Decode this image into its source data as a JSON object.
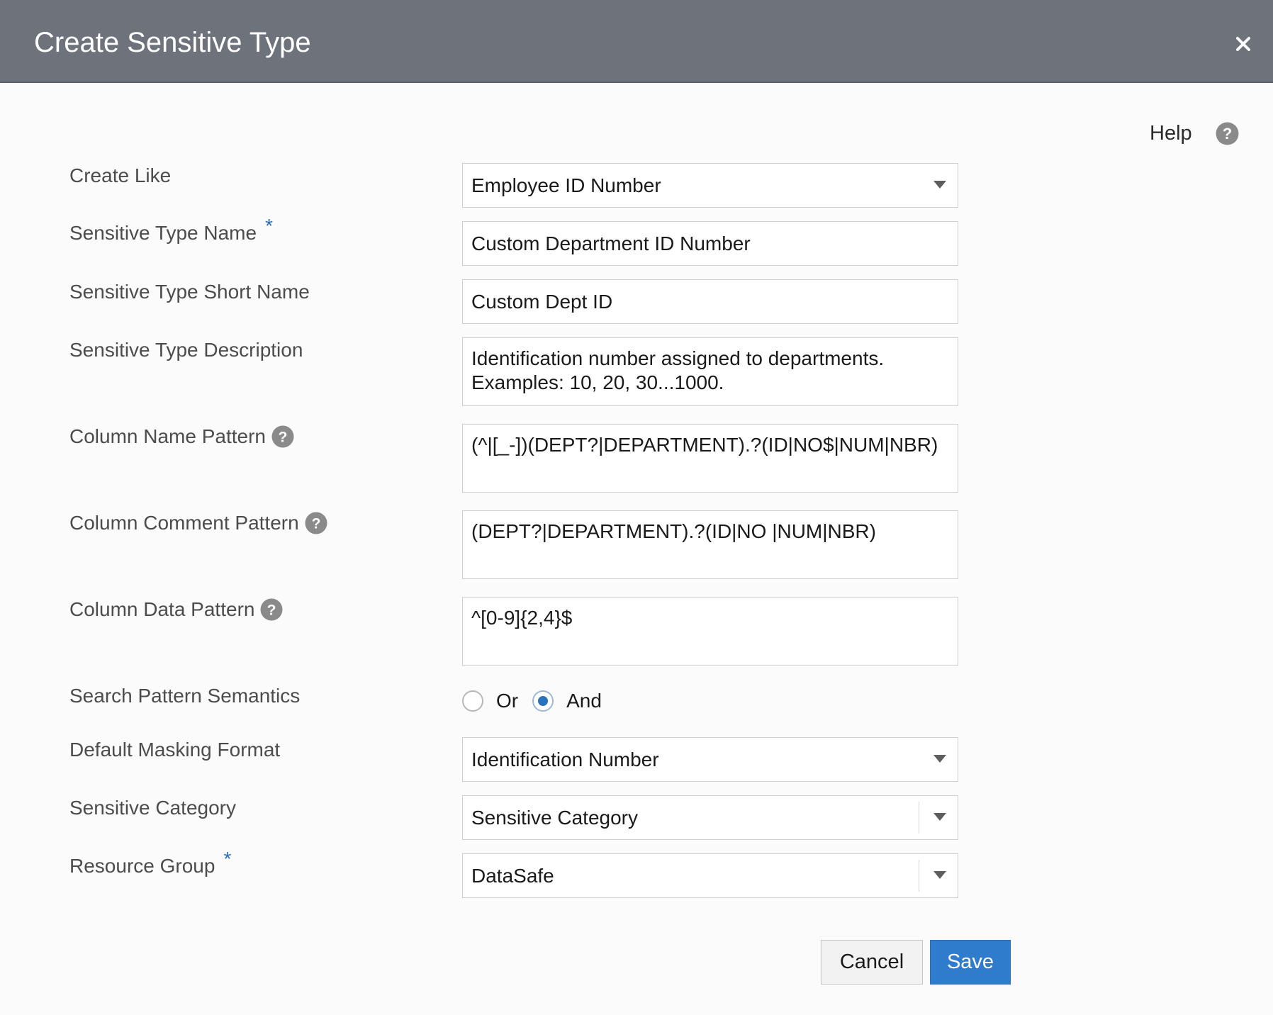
{
  "dialog": {
    "title": "Create Sensitive Type",
    "close_icon": "close-icon",
    "help_label": "Help"
  },
  "form": {
    "create_like": {
      "label": "Create Like",
      "value": "Employee ID Number"
    },
    "type_name": {
      "label": "Sensitive Type Name",
      "required_marker": "*",
      "value": "Custom Department ID Number"
    },
    "short_name": {
      "label": "Sensitive Type Short Name",
      "value": "Custom Dept ID"
    },
    "description": {
      "label": "Sensitive Type Description",
      "value": "Identification number assigned to departments.\nExamples: 10, 20, 30...1000."
    },
    "column_name_pattern": {
      "label": "Column Name Pattern",
      "value": "(^|[_-])(DEPT?|DEPARTMENT).?(ID|NO$|NUM|NBR)"
    },
    "column_comment_pattern": {
      "label": "Column Comment Pattern",
      "value": "(DEPT?|DEPARTMENT).?(ID|NO |NUM|NBR)"
    },
    "column_data_pattern": {
      "label": "Column Data Pattern",
      "value": "^[0-9]{2,4}$"
    },
    "search_semantics": {
      "label": "Search Pattern Semantics",
      "options": [
        "Or",
        "And"
      ],
      "selected": "And"
    },
    "masking_format": {
      "label": "Default Masking Format",
      "value": "Identification Number"
    },
    "category": {
      "label": "Sensitive Category",
      "value": "Sensitive Category"
    },
    "resource_group": {
      "label": "Resource Group",
      "required_marker": "*",
      "value": "DataSafe"
    }
  },
  "buttons": {
    "cancel": "Cancel",
    "save": "Save"
  },
  "colors": {
    "titlebar": "#6e737b",
    "accent": "#2f7ccc",
    "required": "#2c6fb5"
  }
}
